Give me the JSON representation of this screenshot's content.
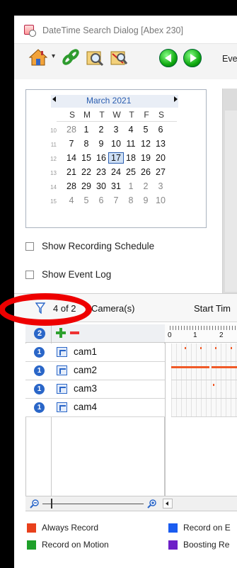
{
  "window": {
    "title": "DateTime Search Dialog [Abex 230]"
  },
  "toolbar": {
    "event_label": "Eve"
  },
  "calendar": {
    "month_label": "March 2021",
    "day_headers": [
      "S",
      "M",
      "T",
      "W",
      "T",
      "F",
      "S"
    ],
    "weeks": [
      {
        "num": "10",
        "days": [
          "28",
          "1",
          "2",
          "3",
          "4",
          "5",
          "6"
        ]
      },
      {
        "num": "11",
        "days": [
          "7",
          "8",
          "9",
          "10",
          "11",
          "12",
          "13"
        ]
      },
      {
        "num": "12",
        "days": [
          "14",
          "15",
          "16",
          "17",
          "18",
          "19",
          "20"
        ]
      },
      {
        "num": "13",
        "days": [
          "21",
          "22",
          "23",
          "24",
          "25",
          "26",
          "27"
        ]
      },
      {
        "num": "14",
        "days": [
          "28",
          "29",
          "30",
          "31",
          "1",
          "2",
          "3"
        ]
      },
      {
        "num": "15",
        "days": [
          "4",
          "5",
          "6",
          "7",
          "8",
          "9",
          "10"
        ]
      }
    ],
    "selected_day": "17"
  },
  "options": {
    "show_recording_schedule": "Show Recording Schedule",
    "show_event_log": "Show Event Log"
  },
  "camera_bar": {
    "count": "4 of 2",
    "label": "Camera(s)",
    "start_time": "Start Tim"
  },
  "grid": {
    "header_badge": "2",
    "cameras": [
      {
        "badge": "1",
        "name": "cam1"
      },
      {
        "badge": "1",
        "name": "cam2"
      },
      {
        "badge": "1",
        "name": "cam3"
      },
      {
        "badge": "1",
        "name": "cam4"
      }
    ],
    "timeline_ticks": [
      "0",
      "1",
      "2"
    ]
  },
  "legend": [
    {
      "label": "Always Record",
      "color": "#e8401c"
    },
    {
      "label": "Record on Motion",
      "color": "#1fa02a"
    },
    {
      "label": "Record on E",
      "color": "#1a5cf0"
    },
    {
      "label": "Boosting Re",
      "color": "#6d1fc7"
    }
  ],
  "colors": {
    "accent": "#2a66c8",
    "record_bar": "#f05a28",
    "highlight": "#e00000"
  }
}
